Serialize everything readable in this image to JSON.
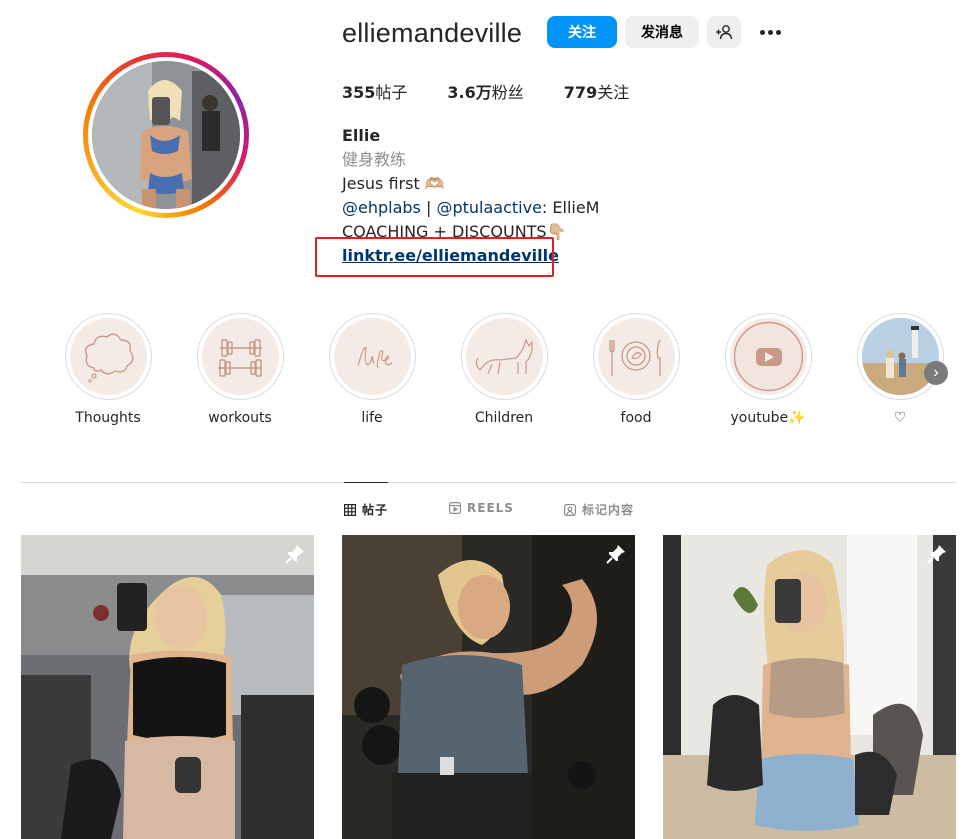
{
  "profile": {
    "username": "elliemandeville",
    "follow_label": "关注",
    "message_label": "发消息",
    "stats": {
      "posts_count": "355",
      "posts_unit": "帖子",
      "followers_count": "3.6万",
      "followers_unit": "粉丝",
      "following_count": "779",
      "following_unit": "关注"
    },
    "bio": {
      "name": "Ellie",
      "category": "健身教练",
      "line1": "Jesus first 🫶🏼",
      "mention1": "@ehplabs",
      "separator": " | ",
      "mention2": "@ptulaactive",
      "mention2_suffix": ": EllieM",
      "line3": "COACHING + DISCOUNTS👇🏼",
      "link": "linktr.ee/elliemandeville"
    }
  },
  "highlights": [
    {
      "label": "Thoughts",
      "icon": "cloud-icon"
    },
    {
      "label": "workouts",
      "icon": "dumbbell-icon"
    },
    {
      "label": "life",
      "icon": "life-script-icon"
    },
    {
      "label": "Children",
      "icon": "cat-icon"
    },
    {
      "label": "food",
      "icon": "plate-icon"
    },
    {
      "label": "youtube✨",
      "icon": "youtube-icon"
    },
    {
      "label": "♡",
      "icon": "photo-highlight"
    }
  ],
  "tabs": [
    {
      "label": "帖子",
      "icon": "grid-icon",
      "active": true
    },
    {
      "label": "REELS",
      "icon": "reels-icon",
      "active": false
    },
    {
      "label": "标记内容",
      "icon": "tagged-icon",
      "active": false
    }
  ],
  "posts": [
    {
      "pinned": true,
      "scene": "gym mirror selfie"
    },
    {
      "pinned": true,
      "scene": "flexing bicep in gym"
    },
    {
      "pinned": true,
      "scene": "mirror selfie at home"
    }
  ],
  "colors": {
    "accent_blue": "#0095f6",
    "link_blue": "#00376b",
    "highlight_bg": "#f5ebe6",
    "highlight_stroke": "#c89a88",
    "annotation_red": "#e02020"
  }
}
